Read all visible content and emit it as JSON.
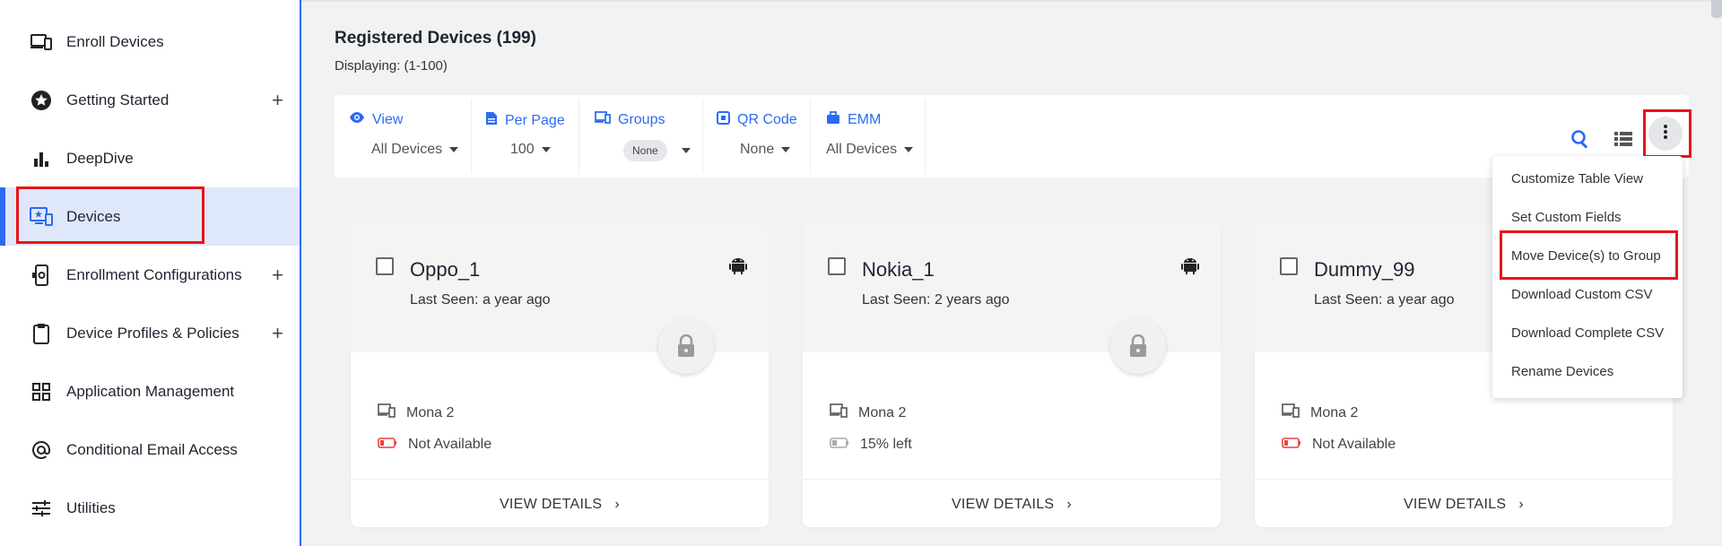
{
  "sidebar": {
    "items": [
      {
        "label": "Enroll Devices",
        "icon": "devices-icon",
        "expandable": false
      },
      {
        "label": "Getting Started",
        "icon": "star-badge-icon",
        "expandable": true
      },
      {
        "label": "DeepDive",
        "icon": "bar-chart-icon",
        "expandable": false
      },
      {
        "label": "Devices",
        "icon": "device-monitor-icon",
        "expandable": false,
        "active": true
      },
      {
        "label": "Enrollment Configurations",
        "icon": "phone-settings-icon",
        "expandable": true
      },
      {
        "label": "Device Profiles & Policies",
        "icon": "clipboard-icon",
        "expandable": true
      },
      {
        "label": "Application Management",
        "icon": "apps-grid-icon",
        "expandable": false
      },
      {
        "label": "Conditional Email Access",
        "icon": "at-sign-icon",
        "expandable": false
      },
      {
        "label": "Utilities",
        "icon": "sliders-icon",
        "expandable": false
      }
    ],
    "plus_symbol": "+"
  },
  "main": {
    "title": "Registered Devices (199)",
    "subtitle": "Displaying: (1-100)"
  },
  "filters": {
    "view": {
      "label": "View",
      "value": "All Devices"
    },
    "per_page": {
      "label": "Per Page",
      "value": "100"
    },
    "groups": {
      "label": "Groups",
      "value": "None"
    },
    "qr_code": {
      "label": "QR Code",
      "value": "None"
    },
    "emm": {
      "label": "EMM",
      "value": "All Devices"
    }
  },
  "menu": {
    "items": [
      "Customize Table View",
      "Set Custom Fields",
      "Move Device(s) to Group",
      "Download Custom CSV",
      "Download Complete CSV",
      "Rename Devices"
    ]
  },
  "cards": [
    {
      "name": "Oppo_1",
      "last_seen": "Last Seen: a year ago",
      "group": "Mona 2",
      "battery": "Not Available",
      "battery_status": "unavailable",
      "details": "VIEW DETAILS"
    },
    {
      "name": "Nokia_1",
      "last_seen": "Last Seen: 2 years ago",
      "group": "Mona 2",
      "battery": "15% left",
      "battery_status": "low",
      "details": "VIEW DETAILS"
    },
    {
      "name": "Dummy_99",
      "last_seen": "Last Seen: a year ago",
      "group": "Mona 2",
      "battery": "Not Available",
      "battery_status": "unavailable",
      "details": "VIEW DETAILS"
    }
  ],
  "colors": {
    "accent": "#2b6bf3",
    "highlight": "#e8141b",
    "battery_red": "#e8453c"
  }
}
